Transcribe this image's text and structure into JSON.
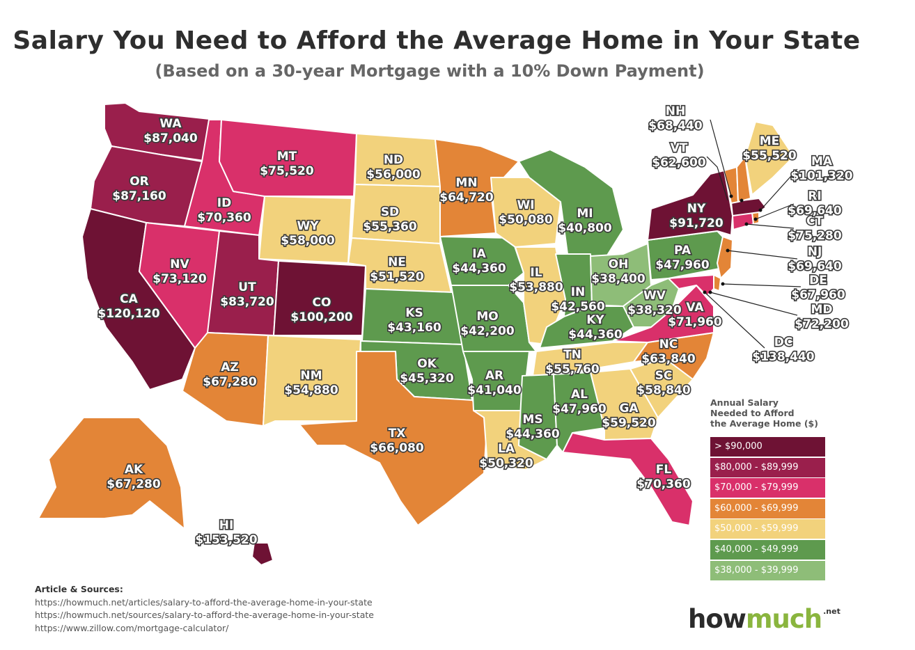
{
  "title": "Salary You Need to Afford the Average Home in Your State",
  "subtitle": "(Based on a 30-year Mortgage with a 10% Down Payment)",
  "legend": {
    "title_lines": [
      "Annual Salary",
      "Needed to Afford",
      "the Average Home ($)"
    ],
    "items": [
      {
        "label": "> $90,000",
        "color": "#6e1234"
      },
      {
        "label": "$80,000 - $89,999",
        "color": "#9a1f4c"
      },
      {
        "label": "$70,000 - $79,999",
        "color": "#d9306a"
      },
      {
        "label": "$60,000 - $69,999",
        "color": "#e38537"
      },
      {
        "label": "$50,000 - $59,999",
        "color": "#f2d27c"
      },
      {
        "label": "$40,000 - $49,999",
        "color": "#5e9a4e"
      },
      {
        "label": "$38,000 - $39,999",
        "color": "#8ebd78"
      }
    ]
  },
  "states": {
    "WA": {
      "name": "WA",
      "value": "$87,040"
    },
    "OR": {
      "name": "OR",
      "value": "$87,160"
    },
    "CA": {
      "name": "CA",
      "value": "$120,120"
    },
    "ID": {
      "name": "ID",
      "value": "$70,360"
    },
    "NV": {
      "name": "NV",
      "value": "$73,120"
    },
    "MT": {
      "name": "MT",
      "value": "$75,520"
    },
    "WY": {
      "name": "WY",
      "value": "$58,000"
    },
    "UT": {
      "name": "UT",
      "value": "$83,720"
    },
    "CO": {
      "name": "CO",
      "value": "$100,200"
    },
    "AZ": {
      "name": "AZ",
      "value": "$67,280"
    },
    "NM": {
      "name": "NM",
      "value": "$54,880"
    },
    "ND": {
      "name": "ND",
      "value": "$56,000"
    },
    "SD": {
      "name": "SD",
      "value": "$55,360"
    },
    "NE": {
      "name": "NE",
      "value": "$51,520"
    },
    "KS": {
      "name": "KS",
      "value": "$43,160"
    },
    "OK": {
      "name": "OK",
      "value": "$45,320"
    },
    "TX": {
      "name": "TX",
      "value": "$66,080"
    },
    "MN": {
      "name": "MN",
      "value": "$64,720"
    },
    "IA": {
      "name": "IA",
      "value": "$44,360"
    },
    "MO": {
      "name": "MO",
      "value": "$42,200"
    },
    "AR": {
      "name": "AR",
      "value": "$41,040"
    },
    "LA": {
      "name": "LA",
      "value": "$50,320"
    },
    "WI": {
      "name": "WI",
      "value": "$50,080"
    },
    "IL": {
      "name": "IL",
      "value": "$53,880"
    },
    "MI": {
      "name": "MI",
      "value": "$40,800"
    },
    "IN": {
      "name": "IN",
      "value": "$42,560"
    },
    "OH": {
      "name": "OH",
      "value": "$38,400"
    },
    "KY": {
      "name": "KY",
      "value": "$44,360"
    },
    "TN": {
      "name": "TN",
      "value": "$55,760"
    },
    "MS": {
      "name": "MS",
      "value": "$44,360"
    },
    "AL": {
      "name": "AL",
      "value": "$47,960"
    },
    "GA": {
      "name": "GA",
      "value": "$59,520"
    },
    "FL": {
      "name": "FL",
      "value": "$70,360"
    },
    "SC": {
      "name": "SC",
      "value": "$58,840"
    },
    "NC": {
      "name": "NC",
      "value": "$63,840"
    },
    "VA": {
      "name": "VA",
      "value": "$71,960"
    },
    "WV": {
      "name": "WV",
      "value": "$38,320"
    },
    "PA": {
      "name": "PA",
      "value": "$47,960"
    },
    "NY": {
      "name": "NY",
      "value": "$91,720"
    },
    "NJ": {
      "name": "NJ",
      "value": "$69,640"
    },
    "DE": {
      "name": "DE",
      "value": "$67,960"
    },
    "MD": {
      "name": "MD",
      "value": "$72,200"
    },
    "DC": {
      "name": "DC",
      "value": "$138,440"
    },
    "CT": {
      "name": "CT",
      "value": "$75,280"
    },
    "RI": {
      "name": "RI",
      "value": "$69,640"
    },
    "MA": {
      "name": "MA",
      "value": "$101,320"
    },
    "VT": {
      "name": "VT",
      "value": "$62,600"
    },
    "NH": {
      "name": "NH",
      "value": "$68,440"
    },
    "ME": {
      "name": "ME",
      "value": "$55,520"
    },
    "AK": {
      "name": "AK",
      "value": "$67,280"
    },
    "HI": {
      "name": "HI",
      "value": "$153,520"
    }
  },
  "sources": {
    "title": "Article & Sources:",
    "lines": [
      "https://howmuch.net/articles/salary-to-afford-the-average-home-in-your-state",
      "https://howmuch.net/sources/salary-to-afford-the-average-home-in-your-state",
      "https://www.zillow.com/mortgage-calculator/"
    ]
  },
  "logo": {
    "how": "how",
    "much": "much",
    "net": ".net"
  }
}
